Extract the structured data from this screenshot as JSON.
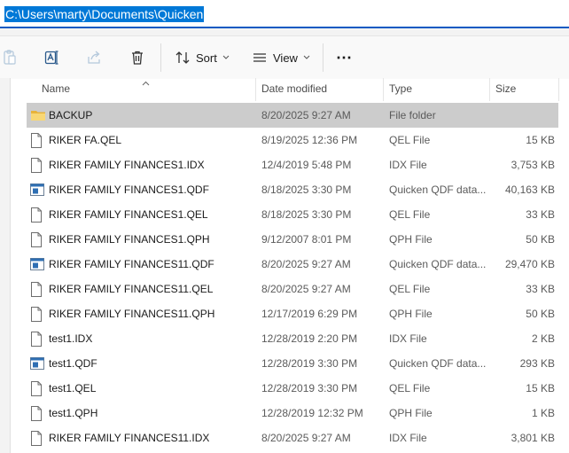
{
  "address": {
    "path": "C:\\Users\\marty\\Documents\\Quicken"
  },
  "toolbar": {
    "sort_label": "Sort",
    "view_label": "View",
    "more_label": "⋯"
  },
  "columns": {
    "name": "Name",
    "date": "Date modified",
    "type": "Type",
    "size": "Size"
  },
  "files": [
    {
      "name": "BACKUP",
      "date": "8/20/2025 9:27 AM",
      "type": "File folder",
      "size": "",
      "icon": "folder-icon",
      "selected": true
    },
    {
      "name": "RIKER FA.QEL",
      "date": "8/19/2025 12:36 PM",
      "type": "QEL File",
      "size": "15 KB",
      "icon": "file-icon"
    },
    {
      "name": "RIKER FAMILY FINANCES1.IDX",
      "date": "12/4/2019 5:48 PM",
      "type": "IDX File",
      "size": "3,753 KB",
      "icon": "file-icon"
    },
    {
      "name": "RIKER FAMILY FINANCES1.QDF",
      "date": "8/18/2025 3:30 PM",
      "type": "Quicken QDF data...",
      "size": "40,163 KB",
      "icon": "quicken-data-icon"
    },
    {
      "name": "RIKER FAMILY FINANCES1.QEL",
      "date": "8/18/2025 3:30 PM",
      "type": "QEL File",
      "size": "33 KB",
      "icon": "file-icon"
    },
    {
      "name": "RIKER FAMILY FINANCES1.QPH",
      "date": "9/12/2007 8:01 PM",
      "type": "QPH File",
      "size": "50 KB",
      "icon": "file-icon"
    },
    {
      "name": "RIKER FAMILY FINANCES11.QDF",
      "date": "8/20/2025 9:27 AM",
      "type": "Quicken QDF data...",
      "size": "29,470 KB",
      "icon": "quicken-data-icon"
    },
    {
      "name": "RIKER FAMILY FINANCES11.QEL",
      "date": "8/20/2025 9:27 AM",
      "type": "QEL File",
      "size": "33 KB",
      "icon": "file-icon"
    },
    {
      "name": "RIKER FAMILY FINANCES11.QPH",
      "date": "12/17/2019 6:29 PM",
      "type": "QPH File",
      "size": "50 KB",
      "icon": "file-icon"
    },
    {
      "name": "test1.IDX",
      "date": "12/28/2019 2:20 PM",
      "type": "IDX File",
      "size": "2 KB",
      "icon": "file-icon"
    },
    {
      "name": "test1.QDF",
      "date": "12/28/2019 3:30 PM",
      "type": "Quicken QDF data...",
      "size": "293 KB",
      "icon": "quicken-data-icon"
    },
    {
      "name": "test1.QEL",
      "date": "12/28/2019 3:30 PM",
      "type": "QEL File",
      "size": "15 KB",
      "icon": "file-icon"
    },
    {
      "name": "test1.QPH",
      "date": "12/28/2019 12:32 PM",
      "type": "QPH File",
      "size": "1 KB",
      "icon": "file-icon"
    },
    {
      "name": "RIKER FAMILY FINANCES11.IDX",
      "date": "8/20/2025 9:27 AM",
      "type": "IDX File",
      "size": "3,801 KB",
      "icon": "file-icon"
    }
  ],
  "colors": {
    "accent": "#0078d7",
    "selection": "#cccccc",
    "folder": "#f4c64f"
  }
}
